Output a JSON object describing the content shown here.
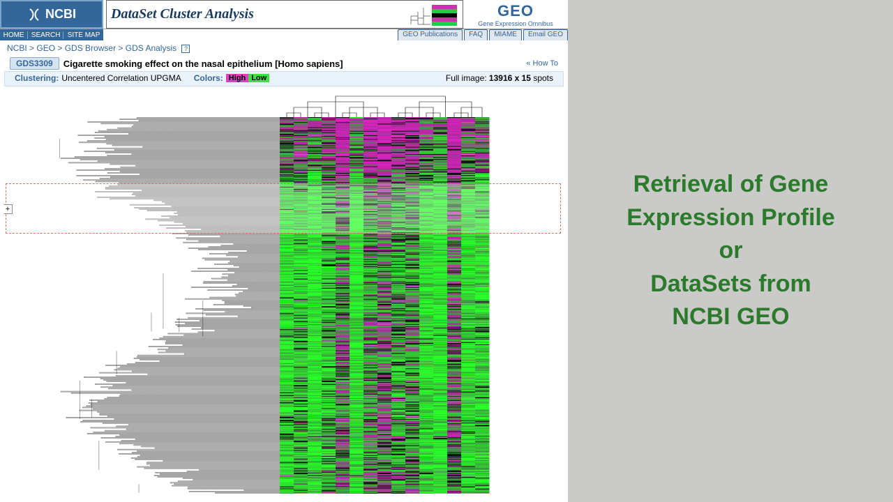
{
  "banner": {
    "ncbi": "NCBI",
    "cluster_title": "DataSet Cluster Analysis",
    "geo_main": "GEO",
    "geo_sub": "Gene Expression Omnibus"
  },
  "left_nav": {
    "home": "HOME",
    "search": "SEARCH",
    "sitemap": "SITE MAP"
  },
  "tabs": {
    "pubs": "GEO Publications",
    "faq": "FAQ",
    "miame": "MIAME",
    "email": "Email GEO"
  },
  "breadcrumb": {
    "ncbi": "NCBI",
    "geo": "GEO",
    "browser": "GDS Browser",
    "analysis": "GDS Analysis",
    "sep": " > ",
    "help": "?"
  },
  "dataset": {
    "gds": "GDS3309",
    "title": "Cigarette smoking effect on the nasal epithelium [Homo sapiens]",
    "howto": "« How To"
  },
  "info": {
    "clustering_label": "Clustering:",
    "clustering_val": "Uncentered Correlation UPGMA",
    "colors_label": "Colors:",
    "high": "High",
    "low": "Low",
    "full_label": "Full image: ",
    "full_dim": "13916 x 15",
    "full_spots": " spots"
  },
  "controls": {
    "plus": "+"
  },
  "right": {
    "line1": "Retrieval of Gene",
    "line2": "Expression Profile",
    "line3": "or",
    "line4": "DataSets from",
    "line5": "NCBI GEO"
  }
}
